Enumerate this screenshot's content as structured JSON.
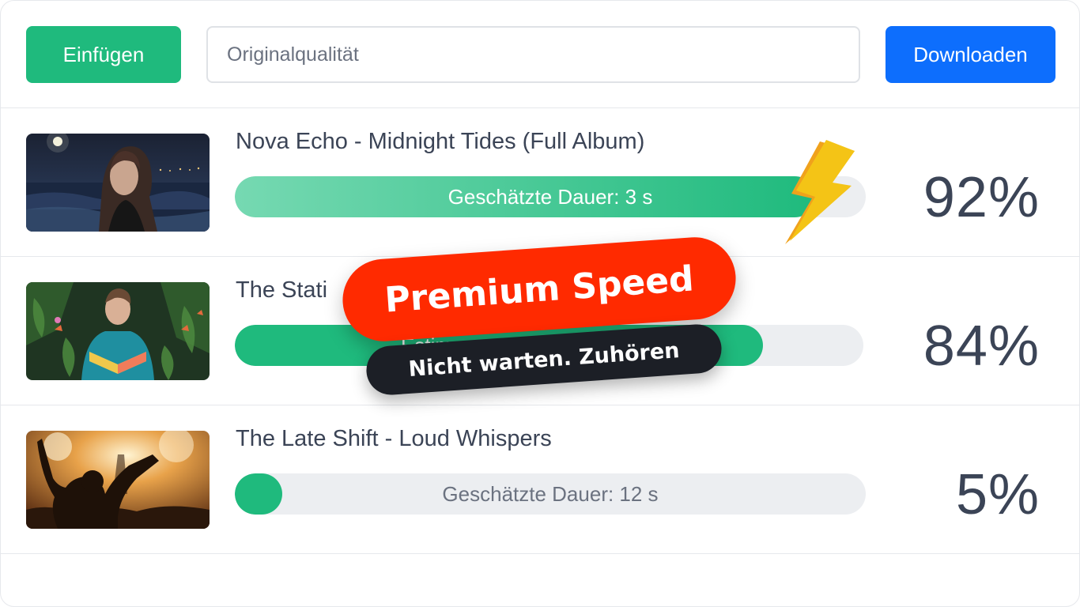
{
  "toolbar": {
    "paste_label": "Einfügen",
    "quality_value": "Originalqualität",
    "download_label": "Downloaden"
  },
  "downloads": [
    {
      "title": "Nova Echo - Midnight Tides (Full Album)",
      "status": "Geschätzte Dauer: 3 s",
      "percent_label": "92%",
      "progress": 0.92,
      "thumbnail": "woman-by-night-sea"
    },
    {
      "title": "The Stati",
      "status": "Estim",
      "percent_label": "84%",
      "progress": 0.84,
      "thumbnail": "man-in-jungle"
    },
    {
      "title": "The Late Shift - Loud Whispers",
      "status": "Geschätzte Dauer: 12 s",
      "percent_label": "5%",
      "progress": 0.05,
      "thumbnail": "concert-crowd"
    }
  ],
  "promo": {
    "headline": "Premium Speed",
    "subline": "Nicht warten. Zuhören",
    "icon": "lightning-bolt-icon"
  },
  "colors": {
    "green": "#1fba7d",
    "blue": "#0d6efd",
    "promo_red": "#ff2a00",
    "promo_dark": "#1c1f26",
    "text": "#3b4456"
  }
}
